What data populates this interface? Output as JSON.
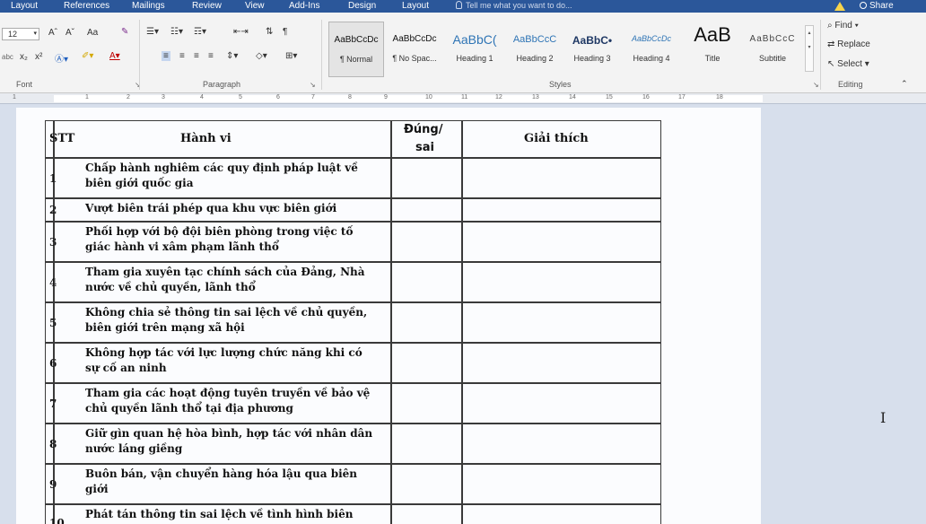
{
  "tabs": [
    "Layout",
    "References",
    "Mailings",
    "Review",
    "View",
    "Add-Ins",
    "Design",
    "Layout"
  ],
  "tell_me": "Tell me what you want to do...",
  "share_label": "Share",
  "ribbon": {
    "font_size": "12",
    "font_group_label": "Font",
    "paragraph_group_label": "Paragraph",
    "styles_group_label": "Styles",
    "editing_group_label": "Editing",
    "grow_font": "Aˆ",
    "shrink_font": "Aˇ",
    "change_case": "Aa",
    "subscript": "x₂",
    "superscript": "x²",
    "strike": "abc",
    "styles": [
      {
        "preview": "AaBbCcDc",
        "name": "¶ Normal"
      },
      {
        "preview": "AaBbCcDc",
        "name": "¶ No Spac..."
      },
      {
        "preview": "AaBbC(",
        "name": "Heading 1"
      },
      {
        "preview": "AaBbCcC",
        "name": "Heading 2"
      },
      {
        "preview": "AaBbC•",
        "name": "Heading 3"
      },
      {
        "preview": "AaBbCcDc",
        "name": "Heading 4"
      },
      {
        "preview": "AaB",
        "name": "Title"
      },
      {
        "preview": "AaBbCcC",
        "name": "Subtitle"
      }
    ],
    "editing": {
      "find": "Find",
      "replace": "Replace",
      "select": "Select"
    }
  },
  "ruler_numbers": [
    "1",
    "1",
    "2",
    "3",
    "4",
    "5",
    "6",
    "7",
    "8",
    "9",
    "10",
    "11",
    "12",
    "13",
    "14",
    "15",
    "16",
    "17",
    "18"
  ],
  "table": {
    "headers": {
      "stt": "STT",
      "action": "Hành vi",
      "tf_line1": "Đúng/",
      "tf_line2": "sai",
      "explain": "Giải thích"
    },
    "rows": [
      {
        "num": "1",
        "line1": "Chấp hành nghiêm các quy định pháp luật về",
        "line2": "biên giới quốc gia"
      },
      {
        "num": "2",
        "line1": "Vượt biên trái phép qua khu vực biên giới",
        "line2": ""
      },
      {
        "num": "3",
        "line1": "Phối hợp với bộ đội biên phòng trong việc tố",
        "line2": "giác hành vi xâm phạm lãnh thổ"
      },
      {
        "num": "4",
        "line1": "Tham gia xuyên tạc chính sách của Đảng, Nhà",
        "line2": "nước về chủ quyền, lãnh thổ"
      },
      {
        "num": "5",
        "line1": "Không chia sẻ thông tin sai lệch về chủ quyền,",
        "line2": "biên giới trên mạng xã hội"
      },
      {
        "num": "6",
        "line1": "Không hợp tác với lực lượng chức năng khi có",
        "line2": "sự cố an ninh"
      },
      {
        "num": "7",
        "line1": "Tham gia các hoạt động tuyên truyền về bảo vệ",
        "line2": "chủ quyền lãnh thổ tại địa phương"
      },
      {
        "num": "8",
        "line1": "Giữ gìn quan hệ hòa bình, hợp tác với nhân dân",
        "line2": "nước láng giềng"
      },
      {
        "num": "9",
        "line1": "Buôn bán, vận chuyển hàng hóa lậu qua biên",
        "line2": "giới"
      },
      {
        "num": "10",
        "line1": "Phát tán thông tin sai lệch về tình hình biên",
        "line2": ""
      }
    ]
  },
  "colors": {
    "ribbon_tab_bg": "#2b579a",
    "ribbon_bg": "#f3f3f3",
    "page_bg": "#fbfcfe",
    "doc_bg": "#d7dfec"
  }
}
